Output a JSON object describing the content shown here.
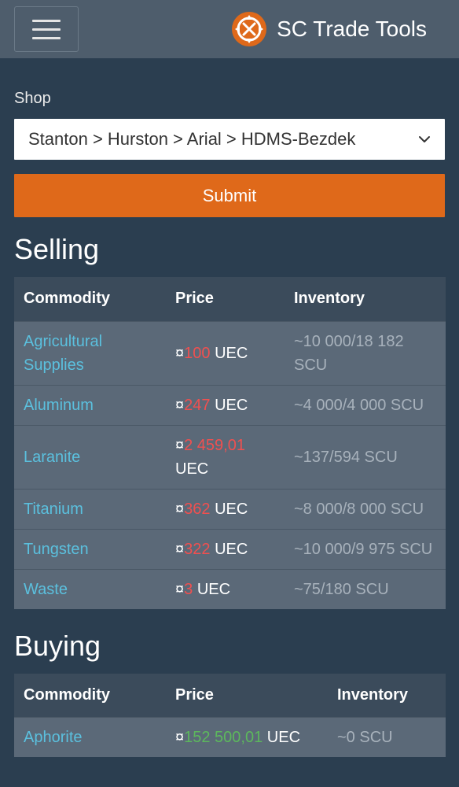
{
  "navbar": {
    "brand": "SC Trade Tools",
    "menu_icon": "hamburger-menu-icon",
    "logo_icon": "sc-trade-tools-logo-icon"
  },
  "shop": {
    "label": "Shop",
    "selected": "Stanton > Hurston > Arial > HDMS-Bezdek",
    "chevron_icon": "chevron-down-icon"
  },
  "submit_label": "Submit",
  "colors": {
    "background": "#2b3e50",
    "navbar": "#4e5d6c",
    "accent": "#df691a",
    "link": "#5bc0de",
    "sell_price": "#f05050",
    "buy_price": "#5cb85c"
  },
  "selling": {
    "heading": "Selling",
    "columns": [
      "Commodity",
      "Price",
      "Inventory"
    ],
    "rows": [
      {
        "commodity": "Agricultural Supplies",
        "currency": "¤",
        "price": "100",
        "unit": "UEC",
        "inventory": "~10 000/18 182 SCU"
      },
      {
        "commodity": "Aluminum",
        "currency": "¤",
        "price": "247",
        "unit": "UEC",
        "inventory": "~4 000/4 000 SCU"
      },
      {
        "commodity": "Laranite",
        "currency": "¤",
        "price": "2 459,01",
        "unit": "UEC",
        "inventory": "~137/594 SCU"
      },
      {
        "commodity": "Titanium",
        "currency": "¤",
        "price": "362",
        "unit": "UEC",
        "inventory": "~8 000/8 000 SCU"
      },
      {
        "commodity": "Tungsten",
        "currency": "¤",
        "price": "322",
        "unit": "UEC",
        "inventory": "~10 000/9 975 SCU"
      },
      {
        "commodity": "Waste",
        "currency": "¤",
        "price": "3",
        "unit": "UEC",
        "inventory": "~75/180 SCU"
      }
    ]
  },
  "buying": {
    "heading": "Buying",
    "columns": [
      "Commodity",
      "Price",
      "Inventory"
    ],
    "rows": [
      {
        "commodity": "Aphorite",
        "currency": "¤",
        "price": "152 500,01",
        "unit": "UEC",
        "inventory": "~0 SCU"
      }
    ]
  }
}
